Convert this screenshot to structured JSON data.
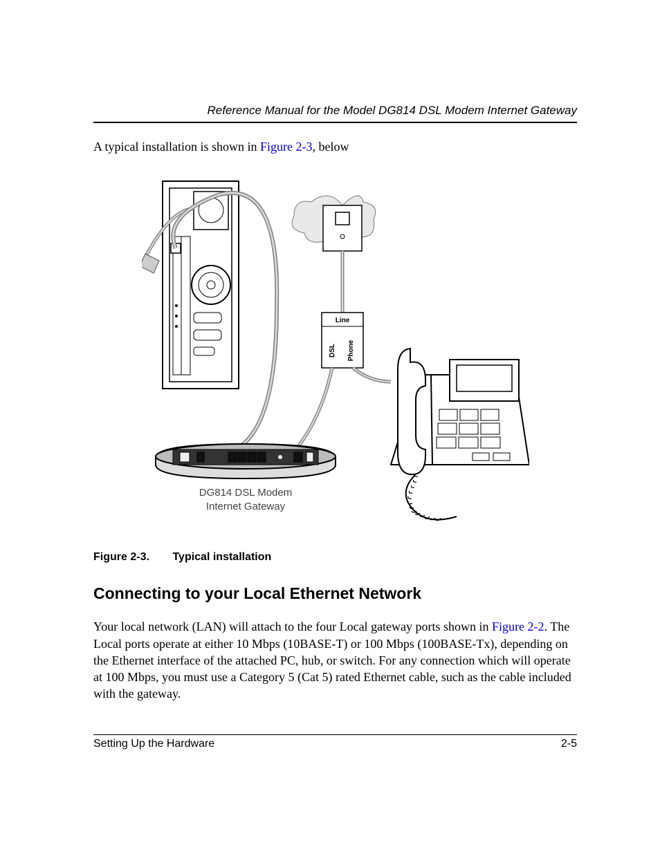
{
  "header": {
    "running_title": "Reference Manual for the Model DG814 DSL Modem Internet Gateway"
  },
  "intro": {
    "before_link": "A typical installation is shown in ",
    "link_text": "Figure 2-3",
    "after_link": ", below"
  },
  "figure": {
    "splitter": {
      "line": "Line",
      "dsl": "DSL",
      "phone": "Phone"
    },
    "device_line1": "DG814 DSL Modem",
    "device_line2": "Internet Gateway",
    "caption_num": "Figure 2-3.",
    "caption_title": "Typical installation"
  },
  "section": {
    "heading": "Connecting to your Local Ethernet Network",
    "para_before_link": "Your local network (LAN) will attach to the four Local gateway ports shown in ",
    "para_link": "Figure 2-2",
    "para_after_link": ". The Local ports operate at either 10 Mbps (10BASE-T) or 100 Mbps (100BASE-Tx), depending on the Ethernet interface of the attached PC, hub, or switch. For any connection which will operate at 100 Mbps, you must use a Category 5 (Cat 5) rated Ethernet cable, such as the cable included with the gateway."
  },
  "footer": {
    "section_name": "Setting Up the Hardware",
    "page_number": "2-5"
  }
}
